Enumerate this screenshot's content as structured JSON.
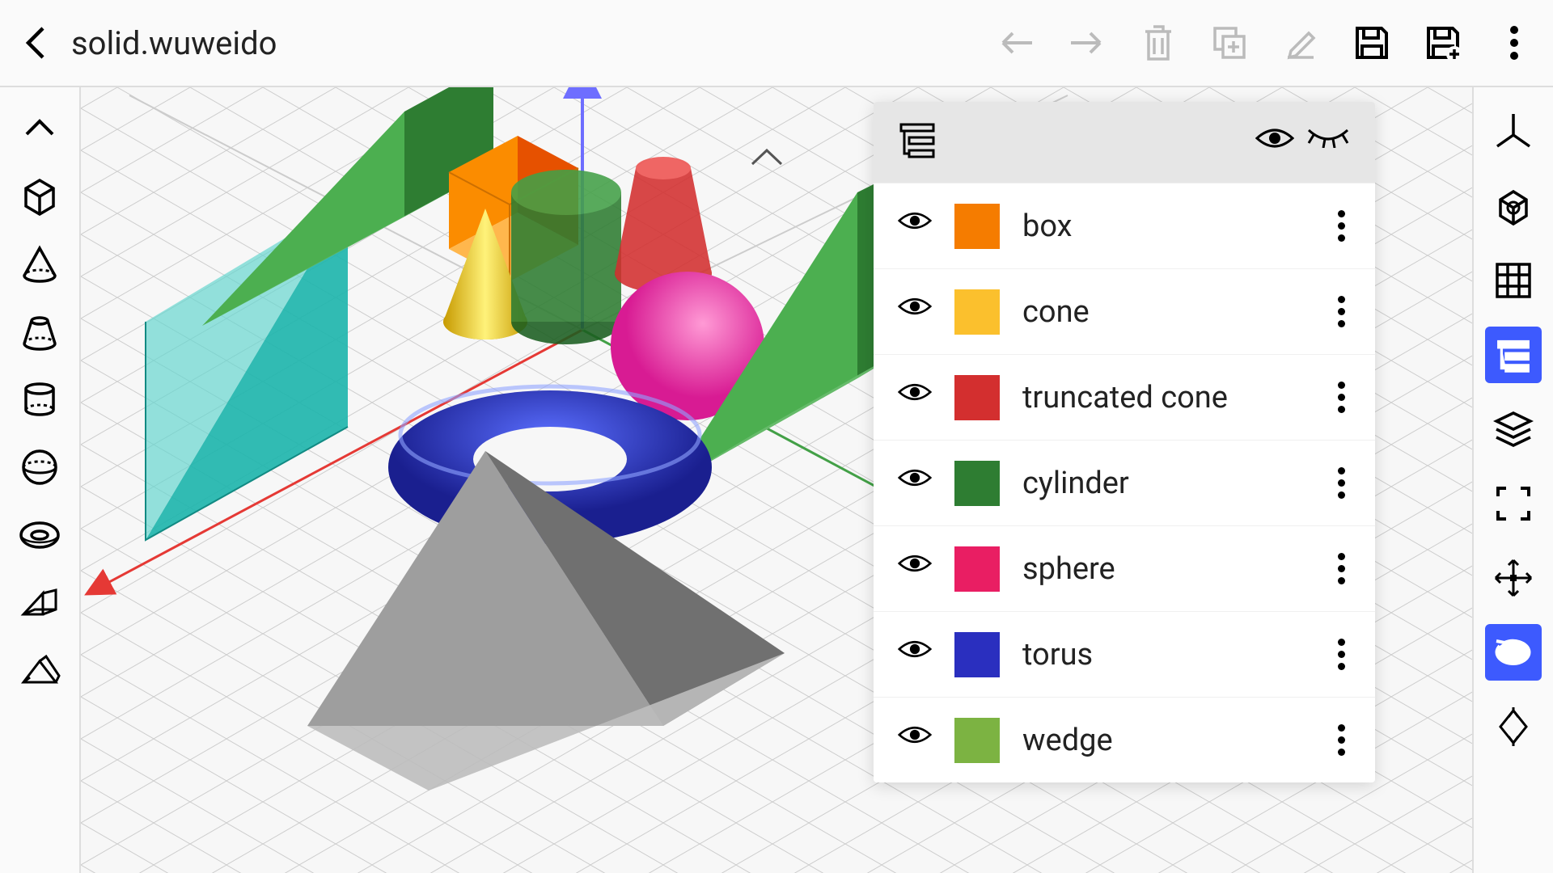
{
  "header": {
    "filename": "solid.wuweido"
  },
  "layers": [
    {
      "name": "box",
      "color": "#f57c00"
    },
    {
      "name": "cone",
      "color": "#fbc02d"
    },
    {
      "name": "truncated cone",
      "color": "#d32f2f"
    },
    {
      "name": "cylinder",
      "color": "#2e7d32"
    },
    {
      "name": "sphere",
      "color": "#e91e63"
    },
    {
      "name": "torus",
      "color": "#2a2fbf"
    },
    {
      "name": "wedge",
      "color": "#7cb342"
    }
  ],
  "right_tools": {
    "active_index": 3
  },
  "colors": {
    "accent": "#3d5afe"
  }
}
